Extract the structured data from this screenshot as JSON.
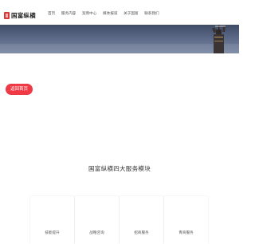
{
  "header": {
    "logo_text": "国富纵横"
  },
  "nav": {
    "items": [
      {
        "label": "首页"
      },
      {
        "label": "服务内容"
      },
      {
        "label": "案例中心"
      },
      {
        "label": "媒体报道"
      },
      {
        "label": "关于国富"
      },
      {
        "label": "联系我们"
      }
    ]
  },
  "hero": {
    "button_label": "返回首页"
  },
  "services": {
    "title": "国富纵横四大服务模块",
    "cards": [
      {
        "label": "技能提升"
      },
      {
        "label": "战略咨询"
      },
      {
        "label": "招商服务"
      },
      {
        "label": "青商服务"
      }
    ]
  },
  "colors": {
    "accent": "#ef3a45",
    "logo": "#d83a3a",
    "banner_dark": "#3f4c66"
  }
}
